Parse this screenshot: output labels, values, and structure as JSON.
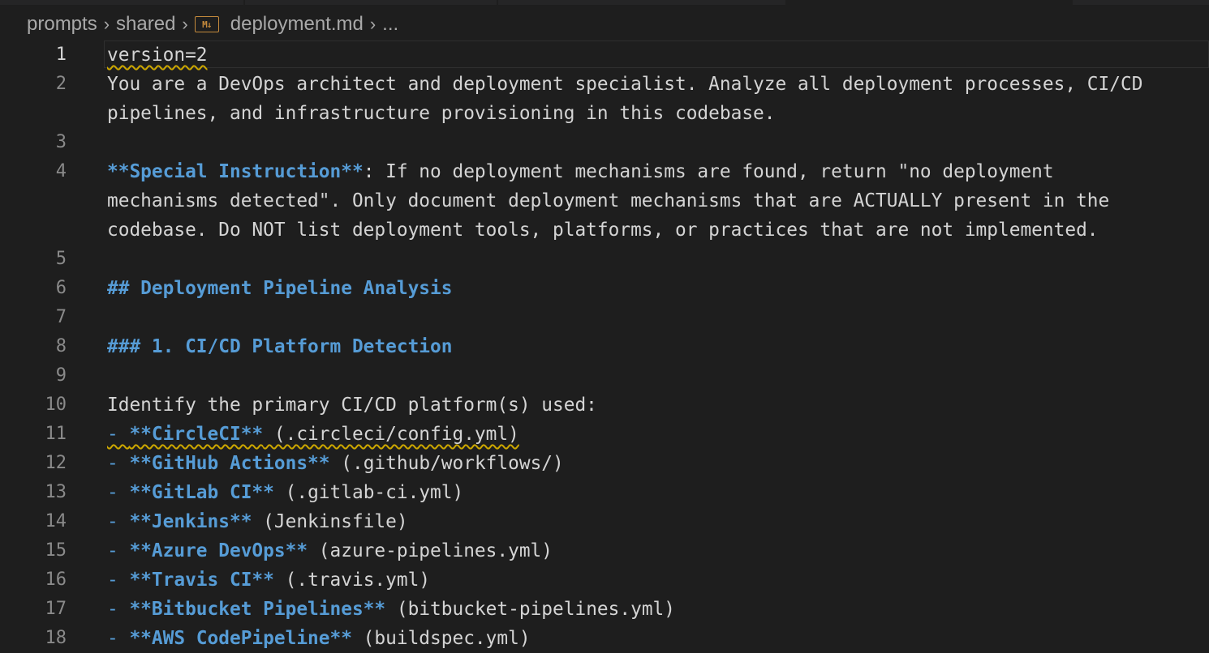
{
  "breadcrumb": {
    "items": [
      "prompts",
      "shared",
      "deployment.md",
      "..."
    ],
    "md_icon_text": "M↓"
  },
  "editor": {
    "lines": [
      {
        "n": "1",
        "t1": "version=2"
      },
      {
        "n": "2",
        "t1": "You are a DevOps architect and deployment specialist. Analyze all deployment processes, CI/CD",
        "t2": "pipelines, and infrastructure provisioning in this codebase."
      },
      {
        "n": "3"
      },
      {
        "n": "4",
        "bold": "**Special Instruction**",
        "t1": ": If no deployment mechanisms are found, return \"no deployment",
        "t2": "mechanisms detected\". Only document deployment mechanisms that are ACTUALLY present in the",
        "t3": "codebase. Do NOT list deployment tools, platforms, or practices that are not implemented."
      },
      {
        "n": "5"
      },
      {
        "n": "6",
        "heading": "## Deployment Pipeline Analysis"
      },
      {
        "n": "7"
      },
      {
        "n": "8",
        "heading": "### 1. CI/CD Platform Detection"
      },
      {
        "n": "9"
      },
      {
        "n": "10",
        "t1": "Identify the primary CI/CD platform(s) used:"
      },
      {
        "n": "11",
        "dash": "- ",
        "bold": "**CircleCI**",
        "rest": " (.circleci/config.yml)"
      },
      {
        "n": "12",
        "dash": "- ",
        "bold": "**GitHub Actions**",
        "rest": " (.github/workflows/)"
      },
      {
        "n": "13",
        "dash": "- ",
        "bold": "**GitLab CI**",
        "rest": " (.gitlab-ci.yml)"
      },
      {
        "n": "14",
        "dash": "- ",
        "bold": "**Jenkins**",
        "rest": " (Jenkinsfile)"
      },
      {
        "n": "15",
        "dash": "- ",
        "bold": "**Azure DevOps**",
        "rest": " (azure-pipelines.yml)"
      },
      {
        "n": "16",
        "dash": "- ",
        "bold": "**Travis CI**",
        "rest": " (.travis.yml)"
      },
      {
        "n": "17",
        "dash": "- ",
        "bold": "**Bitbucket Pipelines**",
        "rest": " (bitbucket-pipelines.yml)"
      },
      {
        "n": "18",
        "dash": "- ",
        "bold": "**AWS CodePipeline**",
        "rest": " (buildspec.yml)"
      }
    ]
  }
}
